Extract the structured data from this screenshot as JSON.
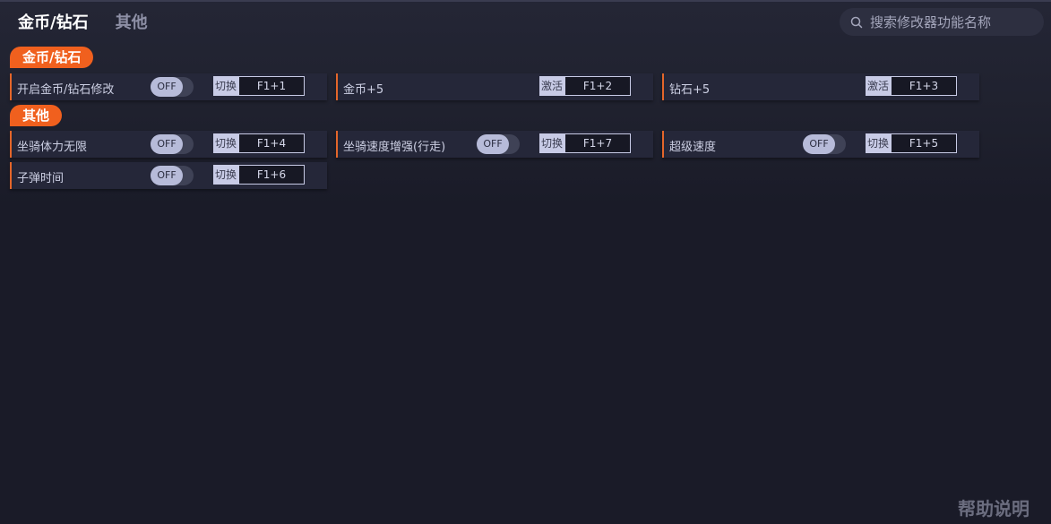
{
  "tabs": [
    {
      "label": "金币/钻石"
    },
    {
      "label": "其他"
    }
  ],
  "search": {
    "placeholder": "搜索修改器功能名称"
  },
  "sections": [
    {
      "title": "金币/钻石",
      "items": [
        {
          "label": "开启金币/钻石修改",
          "toggle": "OFF",
          "action": "切换",
          "hotkey": "F1+1"
        },
        {
          "label": "金币+5",
          "action": "激活",
          "hotkey": "F1+2"
        },
        {
          "label": "钻石+5",
          "action": "激活",
          "hotkey": "F1+3"
        }
      ]
    },
    {
      "title": "其他",
      "items": [
        {
          "label": "坐骑体力无限",
          "toggle": "OFF",
          "action": "切换",
          "hotkey": "F1+4"
        },
        {
          "label": "坐骑速度增强(行走)",
          "toggle": "OFF",
          "action": "切换",
          "hotkey": "F1+7"
        },
        {
          "label": "超级速度",
          "toggle": "OFF",
          "action": "切换",
          "hotkey": "F1+5"
        },
        {
          "label": "子弹时间",
          "toggle": "OFF",
          "action": "切换",
          "hotkey": "F1+6"
        }
      ]
    }
  ],
  "help_link": "帮助说明",
  "colors": {
    "accent": "#f0601e",
    "background": "#1a1b28",
    "card": "#252739"
  },
  "icons": {
    "search": "search-icon"
  }
}
